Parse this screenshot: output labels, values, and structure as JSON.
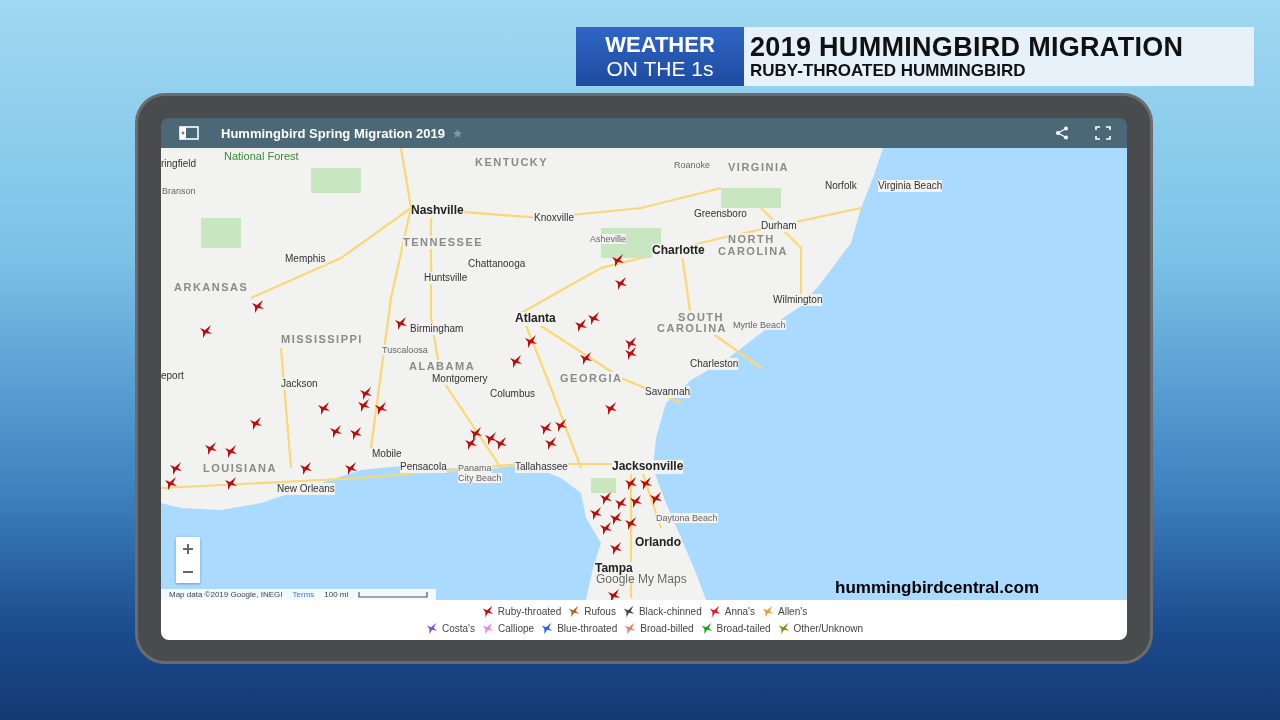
{
  "header": {
    "brand_lines": [
      "WEATHER",
      "ON THE 1s"
    ],
    "title": "2019 HUMMINGBIRD MIGRATION",
    "subtitle": "RUBY-THROATED HUMMINGBIRD"
  },
  "map_window": {
    "title": "Hummingbird Spring Migration 2019",
    "map_labels": [
      {
        "text": "National Forest",
        "kind": "park"
      },
      {
        "text": "ringfield",
        "kind": "city"
      },
      {
        "text": "Branson",
        "kind": "town"
      },
      {
        "text": "KENTUCKY",
        "kind": "state"
      },
      {
        "text": "Roanoke",
        "kind": "town"
      },
      {
        "text": "VIRGINIA",
        "kind": "state"
      },
      {
        "text": "Norfolk",
        "kind": "city"
      },
      {
        "text": "Virginia Beach",
        "kind": "city"
      },
      {
        "text": "Nashville",
        "kind": "major"
      },
      {
        "text": "Knoxville",
        "kind": "city"
      },
      {
        "text": "Greensboro",
        "kind": "city"
      },
      {
        "text": "Durham",
        "kind": "city"
      },
      {
        "text": "TENNESSEE",
        "kind": "state"
      },
      {
        "text": "Asheville",
        "kind": "town"
      },
      {
        "text": "Charlotte",
        "kind": "major"
      },
      {
        "text": "NORTH",
        "kind": "state"
      },
      {
        "text": "CAROLINA",
        "kind": "state"
      },
      {
        "text": "Memphis",
        "kind": "city"
      },
      {
        "text": "Chattanooga",
        "kind": "city"
      },
      {
        "text": "Huntsville",
        "kind": "city"
      },
      {
        "text": "ARKANSAS",
        "kind": "state"
      },
      {
        "text": "Wilmington",
        "kind": "city"
      },
      {
        "text": "Atlanta",
        "kind": "major"
      },
      {
        "text": "Birmingham",
        "kind": "city"
      },
      {
        "text": "SOUTH",
        "kind": "state"
      },
      {
        "text": "CAROLINA",
        "kind": "state"
      },
      {
        "text": "Myrtle Beach",
        "kind": "town"
      },
      {
        "text": "MISSISSIPPI",
        "kind": "state"
      },
      {
        "text": "Tuscaloosa",
        "kind": "town"
      },
      {
        "text": "ALABAMA",
        "kind": "state"
      },
      {
        "text": "Charleston",
        "kind": "city"
      },
      {
        "text": "eport",
        "kind": "city"
      },
      {
        "text": "Jackson",
        "kind": "city"
      },
      {
        "text": "Montgomery",
        "kind": "city"
      },
      {
        "text": "GEORGIA",
        "kind": "state"
      },
      {
        "text": "Columbus",
        "kind": "city"
      },
      {
        "text": "Savannah",
        "kind": "city"
      },
      {
        "text": "Mobile",
        "kind": "city"
      },
      {
        "text": "LOUISIANA",
        "kind": "state"
      },
      {
        "text": "Pensacola",
        "kind": "city"
      },
      {
        "text": "Panama",
        "kind": "town"
      },
      {
        "text": "City Beach",
        "kind": "town"
      },
      {
        "text": "Tallahassee",
        "kind": "city"
      },
      {
        "text": "Jacksonville",
        "kind": "major"
      },
      {
        "text": "New Orleans",
        "kind": "city"
      },
      {
        "text": "Daytona Beach",
        "kind": "town"
      },
      {
        "text": "Orlando",
        "kind": "major"
      },
      {
        "text": "Tampa",
        "kind": "major"
      }
    ],
    "attribution": "Map data ©2019 Google, INEGI",
    "terms": "Terms",
    "scale": "100 mi",
    "logo": "Google My Maps",
    "legend": [
      {
        "name": "Ruby-throated",
        "color": "#b80f0f"
      },
      {
        "name": "Rufous",
        "color": "#b5651d"
      },
      {
        "name": "Black-chinned",
        "color": "#444444"
      },
      {
        "name": "Anna's",
        "color": "#e8141c"
      },
      {
        "name": "Allen's",
        "color": "#f29a2e"
      },
      {
        "name": "Costa's",
        "color": "#7b4fe8"
      },
      {
        "name": "Calliope",
        "color": "#f07ef0"
      },
      {
        "name": "Blue-throated",
        "color": "#2a5ee8"
      },
      {
        "name": "Broad-billed",
        "color": "#f07a6a"
      },
      {
        "name": "Broad-tailed",
        "color": "#14a514"
      },
      {
        "name": "Other/Unknown",
        "color": "#8c8c14"
      }
    ]
  },
  "credit": "hummingbirdcentral.com"
}
